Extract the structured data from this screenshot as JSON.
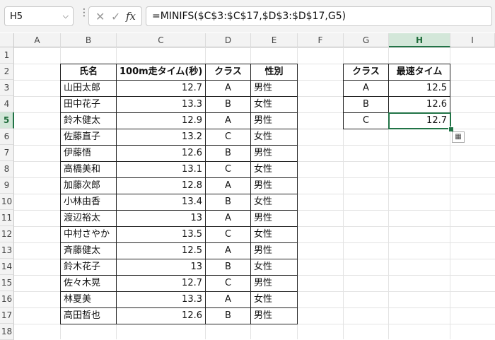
{
  "formula_bar": {
    "name_box": "H5",
    "formula": "=MINIFS($C$3:$C$17,$D$3:$D$17,G5)"
  },
  "columns": [
    "A",
    "B",
    "C",
    "D",
    "E",
    "F",
    "G",
    "H",
    "I"
  ],
  "rows": [
    "1",
    "2",
    "3",
    "4",
    "5",
    "6",
    "7",
    "8",
    "9",
    "10",
    "11",
    "12",
    "13",
    "14",
    "15",
    "16",
    "17",
    "18"
  ],
  "table1": {
    "headers": [
      "氏名",
      "100m走タイム(秒)",
      "クラス",
      "性別"
    ],
    "rows": [
      [
        "山田太郎",
        "12.7",
        "A",
        "男性"
      ],
      [
        "田中花子",
        "13.3",
        "B",
        "女性"
      ],
      [
        "鈴木健太",
        "12.9",
        "A",
        "男性"
      ],
      [
        "佐藤直子",
        "13.2",
        "C",
        "女性"
      ],
      [
        "伊藤悟",
        "12.6",
        "B",
        "男性"
      ],
      [
        "高橋美和",
        "13.1",
        "C",
        "女性"
      ],
      [
        "加藤次郎",
        "12.8",
        "A",
        "男性"
      ],
      [
        "小林由香",
        "13.4",
        "B",
        "女性"
      ],
      [
        "渡辺裕太",
        "13",
        "A",
        "男性"
      ],
      [
        "中村さやか",
        "13.5",
        "C",
        "女性"
      ],
      [
        "斉藤健太",
        "12.5",
        "A",
        "男性"
      ],
      [
        "鈴木花子",
        "13",
        "B",
        "女性"
      ],
      [
        "佐々木晃",
        "12.7",
        "C",
        "男性"
      ],
      [
        "林夏美",
        "13.3",
        "A",
        "女性"
      ],
      [
        "高田哲也",
        "12.6",
        "B",
        "男性"
      ]
    ]
  },
  "table2": {
    "headers": [
      "クラス",
      "最速タイム"
    ],
    "rows": [
      [
        "A",
        "12.5"
      ],
      [
        "B",
        "12.6"
      ],
      [
        "C",
        "12.7"
      ]
    ]
  },
  "selected_cell": "H5",
  "accent_color": "#217346"
}
